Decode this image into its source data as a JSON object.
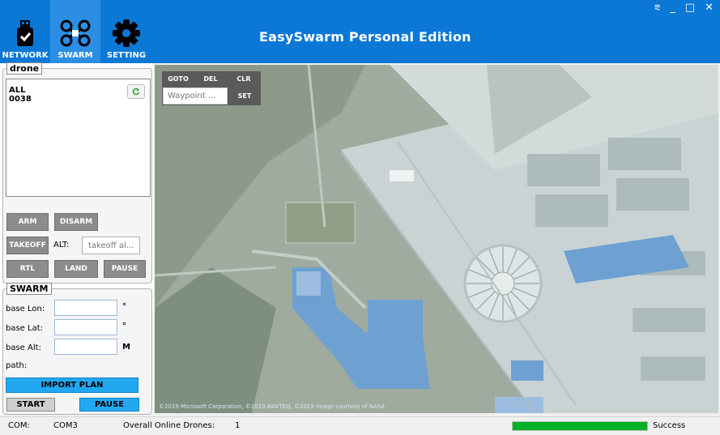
{
  "app": {
    "title": "EasySwarm Personal Edition",
    "window_controls": {
      "pin": "⩳",
      "minimize": "_",
      "maximize": "□",
      "close": "✕"
    }
  },
  "nav": {
    "network": "NETWORK",
    "swarm": "SWARM",
    "setting": "SETTING",
    "active": "swarm"
  },
  "drone_panel": {
    "legend": "drone",
    "items": [
      "ALL",
      "0038"
    ],
    "buttons": {
      "arm": "ARM",
      "disarm": "DISARM",
      "takeoff": "TAKEOFF",
      "rtl": "RTL",
      "land": "LAND",
      "pause": "PAUSE"
    },
    "alt_label": "ALT:",
    "alt_placeholder": "takeoff al..."
  },
  "swarm_panel": {
    "legend": "SWARM",
    "base_lon_label": "base Lon:",
    "base_lat_label": "base Lat:",
    "base_alt_label": "base Alt:",
    "path_label": "path:",
    "lon_unit": "°",
    "lat_unit": "°",
    "alt_unit": "M",
    "base_lon_value": "",
    "base_lat_value": "",
    "base_alt_value": "",
    "import_plan": "IMPORT PLAN",
    "start": "START",
    "pause": "PAUSE"
  },
  "map": {
    "toolbar": {
      "goto": "GOTO",
      "del": "DEL",
      "clr": "CLR",
      "set": "SET"
    },
    "waypoint_placeholder": "Waypoint ...",
    "attribution": "©2019 Microsoft Corporation, ©2019 NAVTEQ, ©2019 Image courtesy of NASA"
  },
  "status": {
    "com_label": "COM:",
    "com_value": "COM3",
    "online_label": "Overall Online Drones:",
    "online_value": "1",
    "progress_fraction": 1.0,
    "progress_text": "Success"
  },
  "colors": {
    "titlebar": "#0b78d6",
    "accent_button": "#22a8f0",
    "gray_button": "#8c8c8c",
    "progress": "#06b025"
  }
}
